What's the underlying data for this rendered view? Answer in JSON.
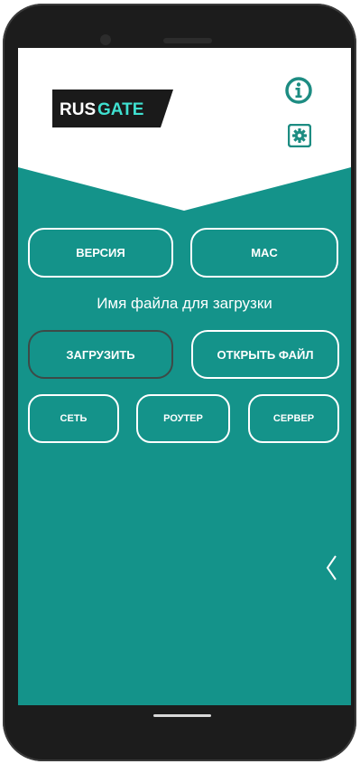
{
  "brand": {
    "logo_text": "RUSGATE",
    "logo_part1": "RUS",
    "logo_part2": "GATE"
  },
  "colors": {
    "teal": "#14938a",
    "frame": "#1c1c1c",
    "logo_accent": "#3fe0d0",
    "button_border": "#ffffff",
    "dark_border": "#3d4a47"
  },
  "header": {
    "info_icon": "info-icon",
    "settings_icon": "gear-icon"
  },
  "buttons": {
    "version": "ВЕРСИЯ",
    "mac": "MAC",
    "upload": "ЗАГРУЗИТЬ",
    "open_file": "ОТКРЫТЬ ФАЙЛ",
    "network": "СЕТЬ",
    "router": "РОУТЕР",
    "server": "СЕРВЕР"
  },
  "file_label": "Имя файла для загрузки",
  "side_panel": {
    "icon": "chevron-left-icon"
  }
}
